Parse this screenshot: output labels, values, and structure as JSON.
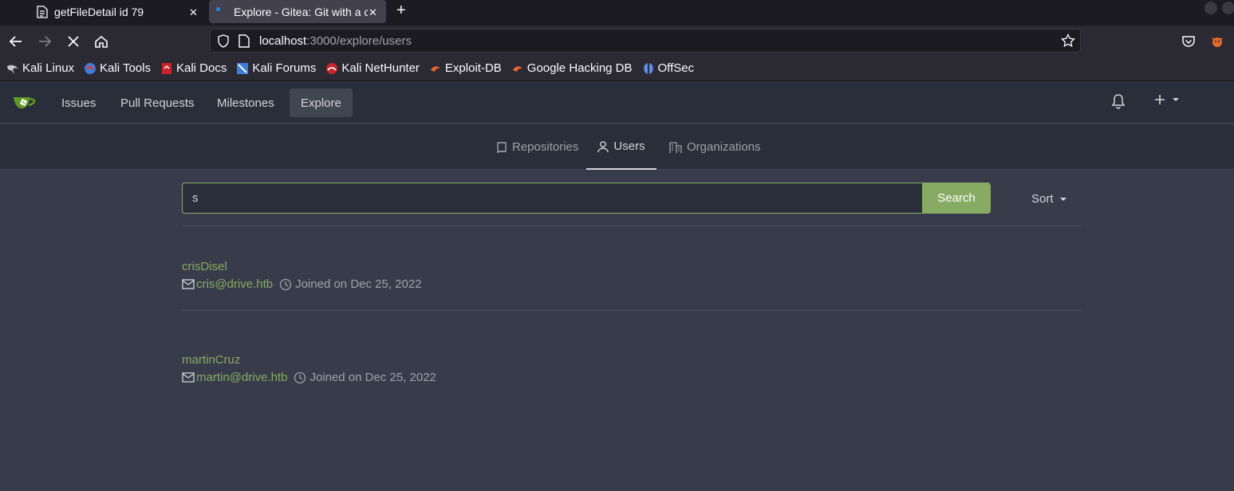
{
  "browser": {
    "tabs": [
      {
        "title": "getFileDetail id 79"
      },
      {
        "title": "Explore - Gitea: Git with a cup of tea"
      }
    ],
    "url_host": "localhost",
    "url_path": ":3000/explore/users",
    "bookmarks": [
      {
        "label": "Kali Linux",
        "icon": "kali-dragon-icon"
      },
      {
        "label": "Kali Tools",
        "icon": "kali-tools-icon"
      },
      {
        "label": "Kali Docs",
        "icon": "kali-docs-icon"
      },
      {
        "label": "Kali Forums",
        "icon": "kali-forums-icon"
      },
      {
        "label": "Kali NetHunter",
        "icon": "kali-nethunter-icon"
      },
      {
        "label": "Exploit-DB",
        "icon": "exploit-db-icon"
      },
      {
        "label": "Google Hacking DB",
        "icon": "ghdb-icon"
      },
      {
        "label": "OffSec",
        "icon": "offsec-icon"
      }
    ]
  },
  "header": {
    "nav": [
      "Issues",
      "Pull Requests",
      "Milestones",
      "Explore"
    ]
  },
  "subnav": {
    "repositories": "Repositories",
    "users": "Users",
    "organizations": "Organizations"
  },
  "search": {
    "value": "s",
    "button": "Search",
    "sort": "Sort"
  },
  "users": [
    {
      "name": "crisDisel",
      "email": "cris@drive.htb",
      "joined": "Joined on Dec 25, 2022"
    },
    {
      "name": "martinCruz",
      "email": "martin@drive.htb",
      "joined": "Joined on Dec 25, 2022"
    }
  ],
  "colors": {
    "accent": "#87ab63",
    "background": "#383c4a",
    "header": "#2a2e3a"
  }
}
